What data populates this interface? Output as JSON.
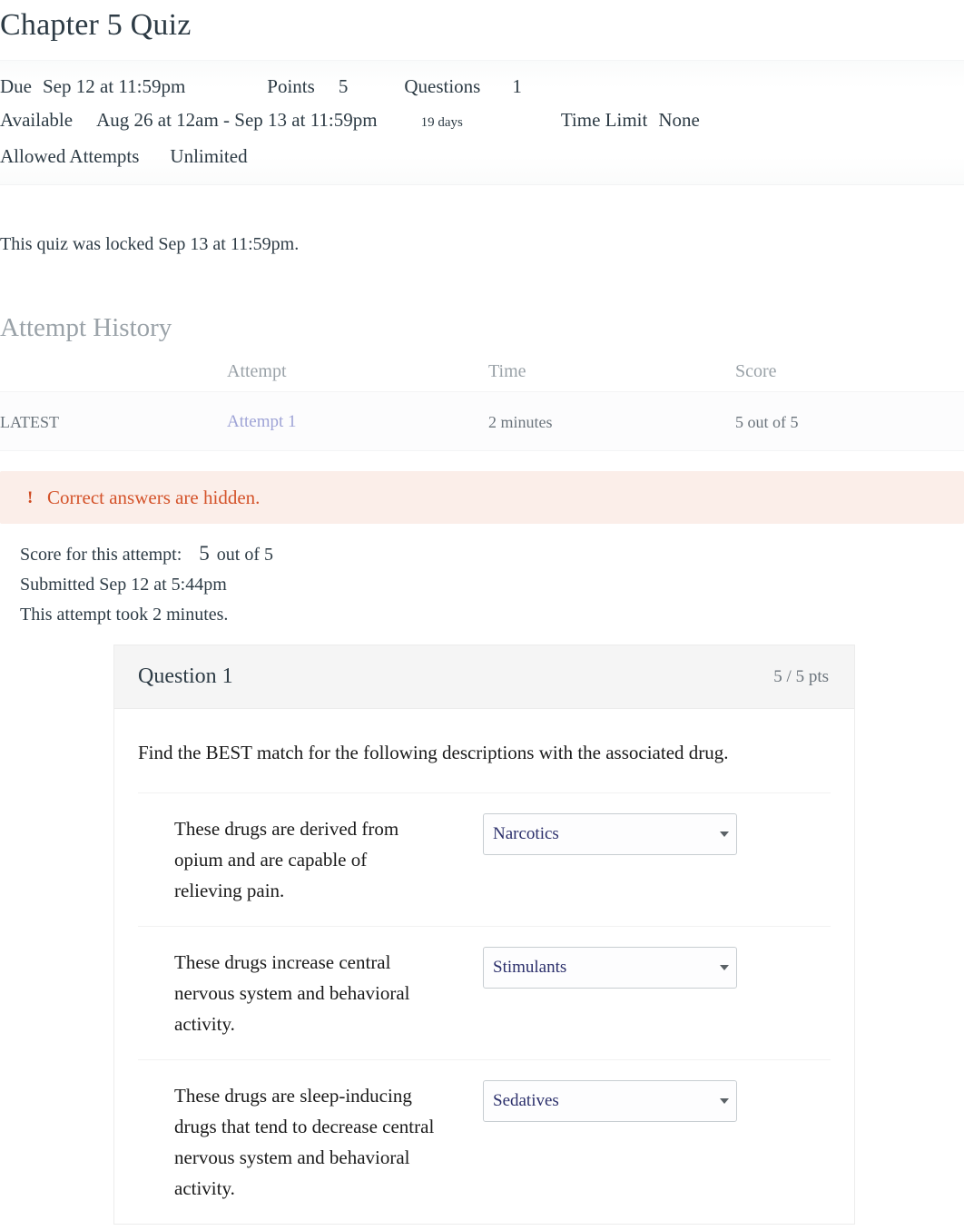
{
  "page": {
    "title": "Chapter 5 Quiz"
  },
  "quiz_meta": {
    "due_label": "Due",
    "due_value": "Sep 12 at 11:59pm",
    "points_label": "Points",
    "points_value": "5",
    "questions_label": "Questions",
    "questions_value": "1",
    "available_label": "Available",
    "available_value": "Aug 26 at 12am - Sep 13 at 11:59pm",
    "available_duration": "19 days",
    "time_limit_label": "Time Limit",
    "time_limit_value": "None",
    "allowed_attempts_label": "Allowed Attempts",
    "allowed_attempts_value": "Unlimited"
  },
  "locked_notice": "This quiz was locked Sep 13 at 11:59pm.",
  "attempt_history": {
    "heading": "Attempt History",
    "columns": [
      "",
      "Attempt",
      "Time",
      "Score"
    ],
    "rows": [
      {
        "kept": "LATEST",
        "attempt": "Attempt 1",
        "time": "2 minutes",
        "score": "5 out of 5"
      }
    ]
  },
  "answers_hidden": {
    "icon": "exclamation-icon",
    "text": "Correct answers are hidden.",
    "bg_color": "#fbeee9",
    "text_color": "#d4532a"
  },
  "attempt_summary": {
    "score_label": "Score for this attempt:",
    "score_value": "5",
    "score_out_of": "out of 5",
    "submitted": "Submitted Sep 12 at 5:44pm",
    "duration": "This attempt took 2 minutes."
  },
  "question": {
    "name": "Question 1",
    "points": "5 / 5 pts",
    "text": "Find the BEST match for the following descriptions with the associated drug.",
    "matches": [
      {
        "prompt": "These drugs are derived from opium and are capable of relieving pain.",
        "answer": "Narcotics"
      },
      {
        "prompt": "These drugs increase central nervous system and behavioral activity.",
        "answer": "Stimulants"
      },
      {
        "prompt": "These drugs are sleep-inducing drugs that tend to decrease central nervous system and behavioral activity.",
        "answer": "Sedatives"
      }
    ]
  }
}
